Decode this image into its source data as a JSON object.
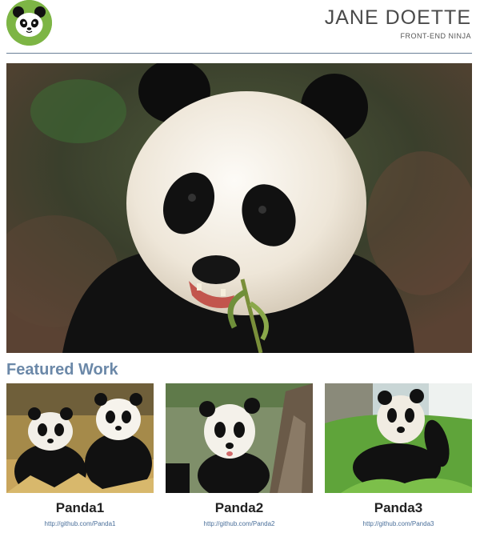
{
  "header": {
    "name": "JANE DOETTE",
    "subtitle": "FRONT-END NINJA",
    "logo_color": "#7db545"
  },
  "main": {
    "hero_alt": "panda photo",
    "featured_title": "Featured Work",
    "projects": [
      {
        "title": "Panda1",
        "link": "http://github.com/Panda1"
      },
      {
        "title": "Panda2",
        "link": "http://github.com/Panda2"
      },
      {
        "title": "Panda3",
        "link": "http://github.com/Panda3"
      }
    ]
  },
  "colors": {
    "accent": "#6b88a8",
    "rule": "#6b7f98"
  }
}
